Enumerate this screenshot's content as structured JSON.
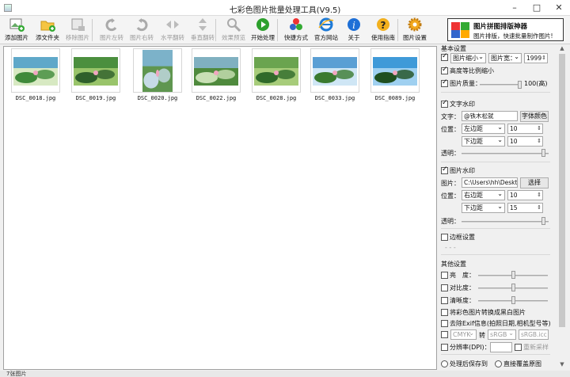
{
  "window": {
    "title": "七彩色图片批量处理工具(V9.5)"
  },
  "toolbar": [
    {
      "key": "add-pic",
      "label": "添加图片",
      "icon": "add-picture-icon",
      "enabled": true
    },
    {
      "key": "add-folder",
      "label": "添文件夹",
      "icon": "add-folder-icon",
      "enabled": true
    },
    {
      "key": "remove-pic",
      "label": "移除图片",
      "icon": "remove-picture-icon",
      "enabled": false
    },
    {
      "key": "rotate-left",
      "label": "图片左转",
      "icon": "rotate-left-icon",
      "enabled": false
    },
    {
      "key": "rotate-right",
      "label": "图片右转",
      "icon": "rotate-right-icon",
      "enabled": false
    },
    {
      "key": "flip-h",
      "label": "水平翻转",
      "icon": "flip-horizontal-icon",
      "enabled": false
    },
    {
      "key": "flip-v",
      "label": "垂直翻转",
      "icon": "flip-vertical-icon",
      "enabled": false
    },
    {
      "key": "preview",
      "label": "效果预览",
      "icon": "magnifier-icon",
      "enabled": false
    },
    {
      "key": "start",
      "label": "开始处理",
      "icon": "play-icon",
      "enabled": true
    },
    {
      "key": "shortcut",
      "label": "快捷方式",
      "icon": "shortcut-icon",
      "enabled": true
    },
    {
      "key": "website",
      "label": "官方网站",
      "icon": "ie-icon",
      "enabled": true
    },
    {
      "key": "about",
      "label": "关于",
      "icon": "info-icon",
      "enabled": true
    },
    {
      "key": "guide",
      "label": "使用指南",
      "icon": "help-icon",
      "enabled": true
    },
    {
      "key": "settings",
      "label": "图片设置",
      "icon": "gear-icon",
      "enabled": true
    }
  ],
  "promo": {
    "title": "图片拼图排版神器",
    "subtitle": "图片排版，快速批量制作图片!"
  },
  "files": [
    {
      "name": "DSC_0018.jpg",
      "tall": false
    },
    {
      "name": "DSC_0019.jpg",
      "tall": false
    },
    {
      "name": "DSC_0020.jpg",
      "tall": true
    },
    {
      "name": "DSC_0022.jpg",
      "tall": false
    },
    {
      "name": "DSC_0028.jpg",
      "tall": false
    },
    {
      "name": "DSC_0033.jpg",
      "tall": false
    },
    {
      "name": "DSC_0089.jpg",
      "tall": false
    }
  ],
  "status": {
    "text": "7张图片"
  },
  "settings": {
    "basic": {
      "header": "基本设置",
      "resize_mode": "图片缩小",
      "dimension": "图片宽：",
      "dimension_value": "1999",
      "keep_ratio": "高度等比例缩小",
      "quality_label": "图片质量：",
      "quality_value": "100(高)"
    },
    "text_watermark": {
      "label": "文字水印",
      "text_label": "文字：",
      "text_value": "@铁木松就",
      "font_color_button": "字体颜色",
      "position_label": "位置：",
      "h_align": "左边距",
      "h_value": "10",
      "v_align": "下边距",
      "v_value": "10",
      "opacity_label": "透明："
    },
    "image_watermark": {
      "label": "图片水印",
      "image_label": "图片：",
      "path": "C:\\Users\\hh\\Deskto",
      "choose_button": "选择",
      "position_label": "位置：",
      "h_align": "右边距",
      "h_value": "10",
      "v_align": "下边距",
      "v_value": "15",
      "opacity_label": "透明："
    },
    "border": {
      "label": "边框设置",
      "hint": "- - -"
    },
    "other": {
      "header": "其他设置",
      "brightness": "亮　度：",
      "contrast": "对比度：",
      "sharpness": "清晰度：",
      "grayscale": "将彩色图片转换成黑白图片",
      "remove_exif": "去除Exif信息(拍照日期,相机型号等)",
      "cmyk_from": "CMYK",
      "convert": "转",
      "cmyk_to": "sRGB",
      "icc": "sRGB.icc",
      "dpi": "分辨率(DPI)：",
      "resample": "重新采样"
    },
    "output": {
      "save_to": "处理后保存到",
      "overwrite": "直接覆盖原图"
    }
  }
}
